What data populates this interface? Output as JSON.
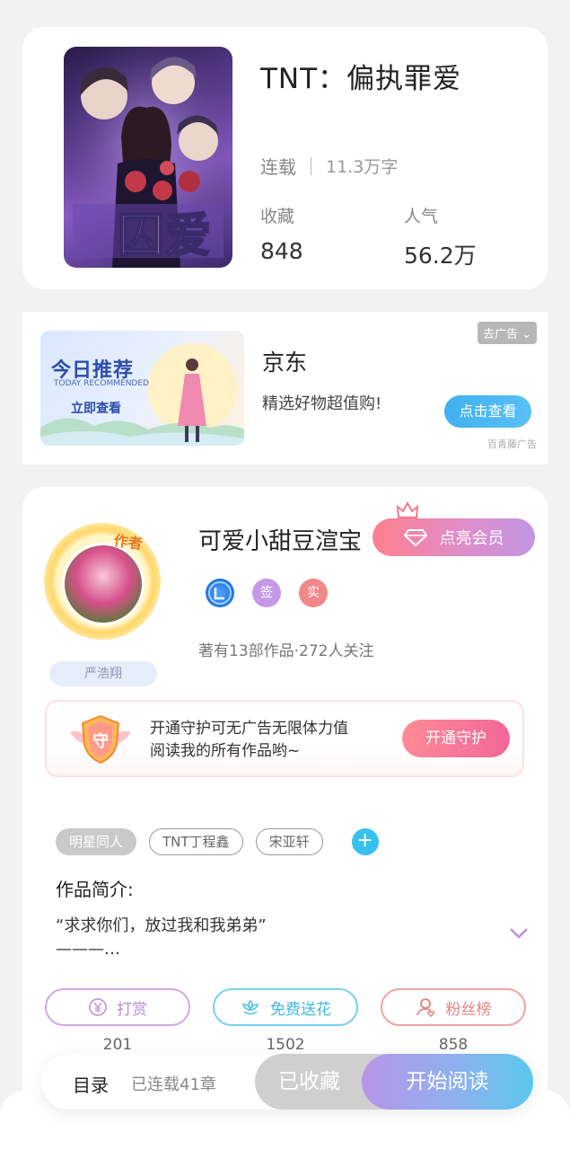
{
  "book": {
    "title": "TNT：偏执罪爱",
    "status": "连载",
    "word_count": "11.3万字",
    "stats": [
      {
        "label": "收藏",
        "value": "848"
      },
      {
        "label": "人气",
        "value": "56.2万"
      }
    ],
    "cover_text": "囚爱"
  },
  "ad": {
    "remove_label": "去广告",
    "banner_title": "今日推荐",
    "banner_subtitle": "TODAY RECOMMENDED",
    "banner_cta": "立即查看",
    "name": "京东",
    "description": "精选好物超值购!",
    "button_label": "点击查看",
    "source": "百青藤广告"
  },
  "author": {
    "name": "可爱小甜豆渲宝",
    "tag": "作者",
    "pen_name": "严浩翔",
    "vip_label": "点亮会员",
    "badges": [
      "签",
      "实"
    ],
    "meta": "著有13部作品·272人关注"
  },
  "guard": {
    "text_line1": "开通守护可无广告无限体力值",
    "text_line2": "阅读我的所有作品哟~",
    "shield_char": "守",
    "button_label": "开通守护"
  },
  "tags": [
    "明星同人",
    "TNT丁程鑫",
    "宋亚轩"
  ],
  "intro": {
    "title": "作品简介:",
    "line1": "“求求你们，放过我和我弟弟”",
    "line2": "———…"
  },
  "actions": [
    {
      "label": "打赏",
      "count": "201",
      "icon": "yen-icon"
    },
    {
      "label": "免费送花",
      "count": "1502",
      "icon": "flower-icon"
    },
    {
      "label": "粉丝榜",
      "count": "858",
      "icon": "fans-icon"
    }
  ],
  "bottom": {
    "toc_label": "目录",
    "toc_info": "已连载41章",
    "collected_label": "已收藏",
    "read_label": "开始阅读"
  }
}
